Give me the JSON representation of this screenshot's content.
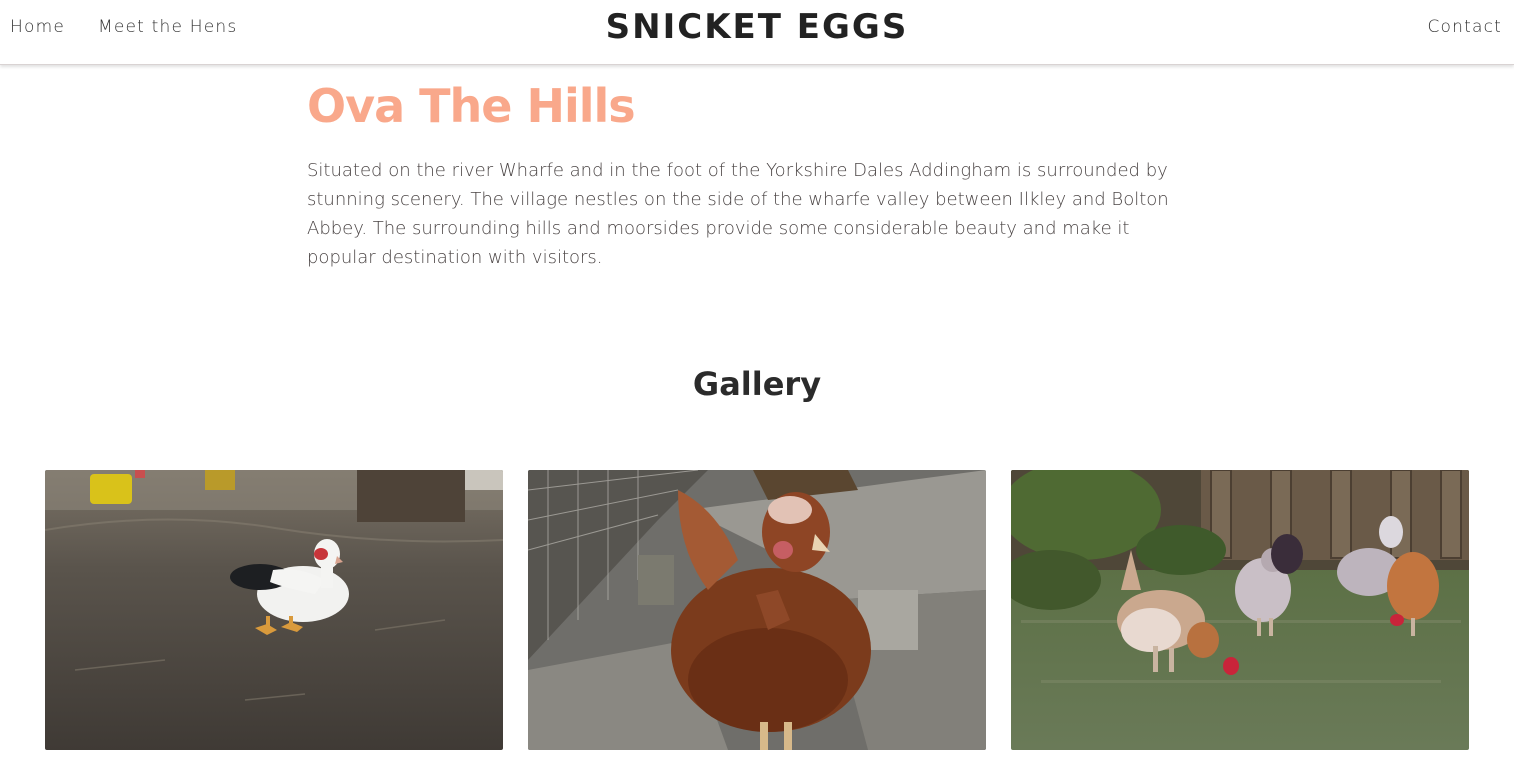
{
  "nav": {
    "home": "Home",
    "hens": "Meet the Hens",
    "brand": "SNICKET EGGS",
    "contact": "Contact"
  },
  "page": {
    "heading": "Ova The Hills",
    "intro": "Situated on the river Wharfe and in the foot of the Yorkshire Dales Addingham is surrounded by stunning scenery. The village nestles on the side of the wharfe valley between Ilkley and Bolton Abbey. The surrounding hills and moorsides provide some considerable beauty and make it popular destination with visitors."
  },
  "gallery": {
    "title": "Gallery",
    "photos": [
      {
        "subject": "duck-photo"
      },
      {
        "subject": "hen-closeup-photo"
      },
      {
        "subject": "hens-in-garden-photo"
      }
    ]
  },
  "colors": {
    "accent": "#f9a88b",
    "text": "#333333",
    "nav_border": "#d9d3d3"
  }
}
